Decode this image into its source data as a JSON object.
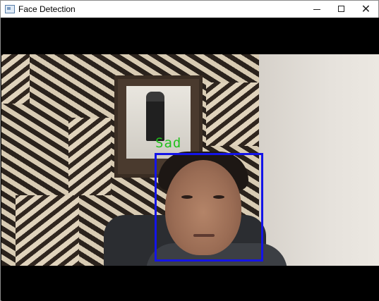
{
  "window": {
    "title": "Face Detection",
    "controls": {
      "close_glyph": "✕"
    }
  },
  "video": {
    "detections": [
      {
        "label": "Sad",
        "box_color": "#1414e8",
        "label_color": "#22c01e"
      }
    ]
  },
  "icons": [
    "app-icon",
    "minimize-icon",
    "maximize-icon",
    "close-icon"
  ]
}
